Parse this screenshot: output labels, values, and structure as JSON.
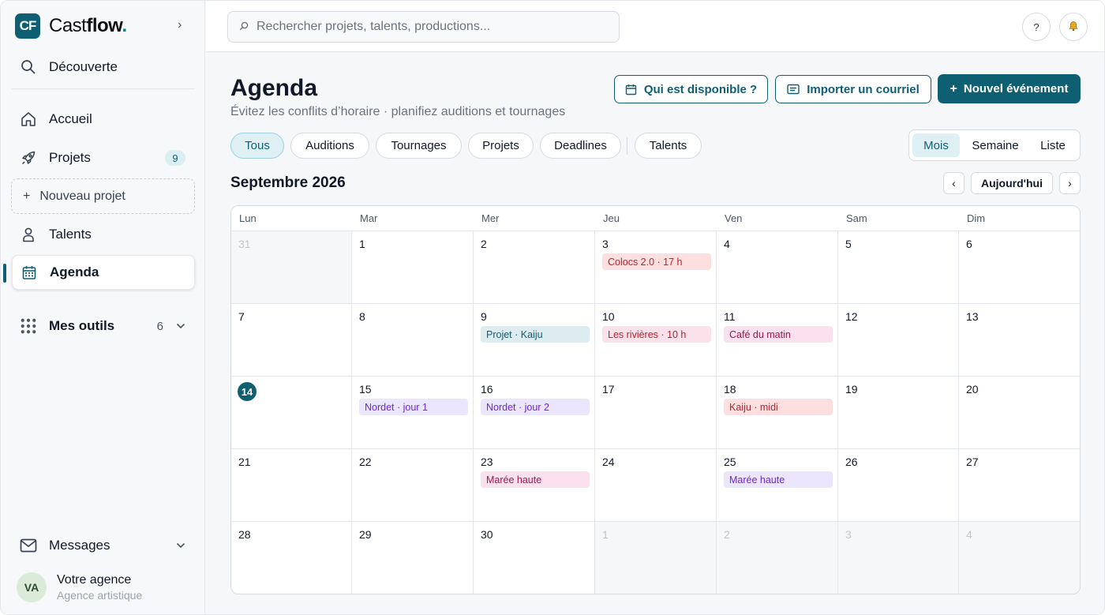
{
  "app": {
    "logo_text": "CF",
    "brand_part1": "Cast",
    "brand_part2": "flow",
    "brand_dot": ".",
    "collapse_glyph": "›"
  },
  "sidebar": {
    "discover": "Découverte",
    "home": "Accueil",
    "projects": "Projets",
    "projects_count": "9",
    "new_project": "Nouveau projet",
    "talents": "Talents",
    "agenda": "Agenda",
    "tools": "Mes outils",
    "tools_count": "6",
    "messages": "Messages",
    "agency_initials": "VA",
    "agency_name": "Votre agence",
    "agency_sub": "Agence artistique"
  },
  "topbar": {
    "search_placeholder": "Rechercher projets, talents, productions...",
    "help_label": "?"
  },
  "page": {
    "title": "Agenda",
    "subtitle": "Évitez les conflits d’horaire · planifiez auditions et tournages",
    "btn_available": "Qui est disponible ?",
    "btn_import": "Importer un courriel",
    "btn_new_event": "Nouvel événement"
  },
  "filters": [
    "Tous",
    "Auditions",
    "Tournages",
    "Projets",
    "Deadlines",
    "Talents"
  ],
  "selected_filter": "Tous",
  "views": [
    "Mois",
    "Semaine",
    "Liste"
  ],
  "selected_view": "Mois",
  "calendar": {
    "month_label": "Septembre 2026",
    "prev": "‹",
    "today_btn": "Aujourd'hui",
    "next": "›",
    "weekdays": [
      "Lun",
      "Mar",
      "Mer",
      "Jeu",
      "Ven",
      "Sam",
      "Dim"
    ],
    "today": "14",
    "weeks": [
      [
        {
          "day": "31",
          "muted": true
        },
        {
          "day": "1"
        },
        {
          "day": "2"
        },
        {
          "day": "3",
          "event": {
            "label": "Colocs 2.0 · 17 h",
            "bg": "#fddfe0",
            "fg": "#b4232e"
          }
        },
        {
          "day": "4"
        },
        {
          "day": "5"
        },
        {
          "day": "6"
        }
      ],
      [
        {
          "day": "7"
        },
        {
          "day": "8"
        },
        {
          "day": "9",
          "event": {
            "label": "Projet · Kaiju",
            "bg": "#dcecf1",
            "fg": "#0f5f73"
          }
        },
        {
          "day": "10",
          "event": {
            "label": "Les rivières · 10 h",
            "bg": "#fbe1ea",
            "fg": "#b4232e"
          }
        },
        {
          "day": "11",
          "event": {
            "label": "Café du matin",
            "bg": "#fbe1ee",
            "fg": "#9d174d"
          }
        },
        {
          "day": "12"
        },
        {
          "day": "13"
        }
      ],
      [
        {
          "day": "14",
          "today": true
        },
        {
          "day": "15",
          "event": {
            "label": "Nordet · jour 1",
            "bg": "#ebe5fd",
            "fg": "#6d28d9"
          }
        },
        {
          "day": "16",
          "event": {
            "label": "Nordet · jour 2",
            "bg": "#ebe5fd",
            "fg": "#6d28d9"
          }
        },
        {
          "day": "17"
        },
        {
          "day": "18",
          "event": {
            "label": "Kaiju · midi",
            "bg": "#fddfe0",
            "fg": "#b4232e"
          }
        },
        {
          "day": "19"
        },
        {
          "day": "20"
        }
      ],
      [
        {
          "day": "21"
        },
        {
          "day": "22"
        },
        {
          "day": "23",
          "event": {
            "label": "Marée haute",
            "bg": "#fbe1ee",
            "fg": "#9d174d"
          }
        },
        {
          "day": "24"
        },
        {
          "day": "25",
          "event": {
            "label": "Marée haute",
            "bg": "#ebe5fd",
            "fg": "#6d28d9"
          }
        },
        {
          "day": "26"
        },
        {
          "day": "27"
        }
      ],
      [
        {
          "day": "28"
        },
        {
          "day": "29"
        },
        {
          "day": "30"
        },
        {
          "day": "1",
          "muted": true
        },
        {
          "day": "2",
          "muted": true
        },
        {
          "day": "3",
          "muted": true
        },
        {
          "day": "4",
          "muted": true
        }
      ]
    ]
  },
  "colors": {
    "brand": "#0f5f73",
    "accent_light": "#def0f4"
  }
}
